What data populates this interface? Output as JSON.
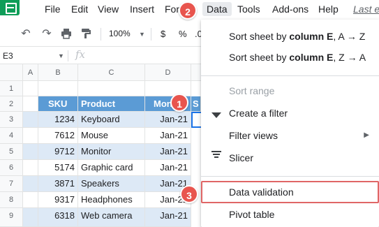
{
  "menubar": {
    "items": [
      "File",
      "Edit",
      "View",
      "Insert",
      "Forr",
      "Data",
      "Tools",
      "Add-ons",
      "Help"
    ],
    "last_edit": "Last e"
  },
  "toolbar": {
    "zoom": "100%",
    "currency": "$",
    "percent": "%",
    "decimal": ".0"
  },
  "formula_bar": {
    "name_box": "E3",
    "fx": "fx"
  },
  "sheet": {
    "columns": [
      "A",
      "B",
      "C",
      "D"
    ],
    "rows": [
      "1",
      "2",
      "3",
      "4",
      "5",
      "6",
      "7",
      "8",
      "9"
    ],
    "headers": [
      "SKU",
      "Product",
      "Mon"
    ],
    "data": [
      [
        "1234",
        "Keyboard",
        "Jan-21"
      ],
      [
        "7612",
        "Mouse",
        "Jan-21"
      ],
      [
        "9712",
        "Monitor",
        "Jan-21"
      ],
      [
        "5174",
        "Graphic card",
        "Jan-21"
      ],
      [
        "3871",
        "Speakers",
        "Jan-21"
      ],
      [
        "9317",
        "Headphones",
        "Jan-21"
      ],
      [
        "6318",
        "Web camera",
        "Jan-21"
      ]
    ],
    "e_header": "S"
  },
  "data_menu": {
    "sort_az_prefix": "Sort sheet by ",
    "sort_az_col": "column E",
    "sort_az_suffix": ", A → Z",
    "sort_za_prefix": "Sort sheet by ",
    "sort_za_col": "column E",
    "sort_za_suffix": ", Z → A",
    "sort_range": "Sort range",
    "create_filter": "Create a filter",
    "filter_views": "Filter views",
    "slicer": "Slicer",
    "data_validation": "Data validation",
    "pivot_table": "Pivot table"
  },
  "badges": [
    "1",
    "2",
    "3"
  ],
  "colors": {
    "header_fill": "#5b9bd5",
    "band_fill": "#dde9f6",
    "badge": "#e8554e",
    "highlight_box": "#e06666",
    "selection": "#1a73e8"
  }
}
